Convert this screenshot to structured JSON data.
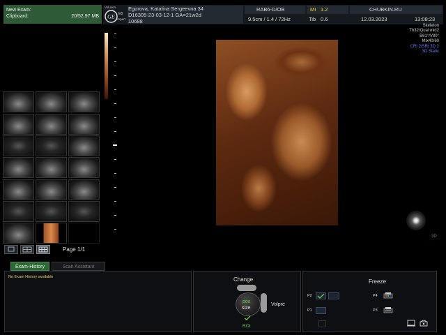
{
  "clipboard": {
    "title": "New Exam:",
    "label": "Clipboard:",
    "size": "20/52.97 MB",
    "page_label": "Page 1/1"
  },
  "header": {
    "brand": "Voluson",
    "probe_tag1": "E8",
    "probe_tag2": "Expert",
    "patient_name": "Egorova, Katalina Sergeevna 34",
    "patient_id": "D16305-23-03-12-1  GA=21w2d",
    "patient_sub": "10688",
    "probe": "RAB6-D/OB",
    "depth": "9.5cm / 1.4 / 72Hz",
    "mi_label": "MI",
    "mi_value": "1.2",
    "tib_label": "Tib",
    "tib_value": "0.6",
    "site": "CHUBKIN.RU",
    "date": "12.03.2023",
    "time": "13:08:23"
  },
  "params": {
    "lines": [
      "Skeleton",
      "Th32/Qual mid2",
      "B61°/V80°",
      "Mix40/60"
    ],
    "blue_lines": [
      "CRI 2/SRI 3D 2",
      "3D Static"
    ]
  },
  "corner_mark": "3D",
  "bottom": {
    "tabs": [
      "Exam-History",
      "Scan Assistant"
    ],
    "history_message": "No Exam History available",
    "change_label": "Change",
    "pos_label": "pos",
    "size_label": "size",
    "volpre_label": "Volpre",
    "roi_label": "ROI",
    "freeze_label": "Freeze",
    "p2": "P2",
    "p1": "P1",
    "p4": "P4",
    "p3": "P3"
  },
  "colors": {
    "clipboard_bg": "#2f5a37",
    "tab_active": "#2b6a34",
    "history_text": "#e8d25a",
    "accent_green": "#66cc44",
    "mi_color": "#f0d040",
    "param_blue": "#6f7cff"
  }
}
